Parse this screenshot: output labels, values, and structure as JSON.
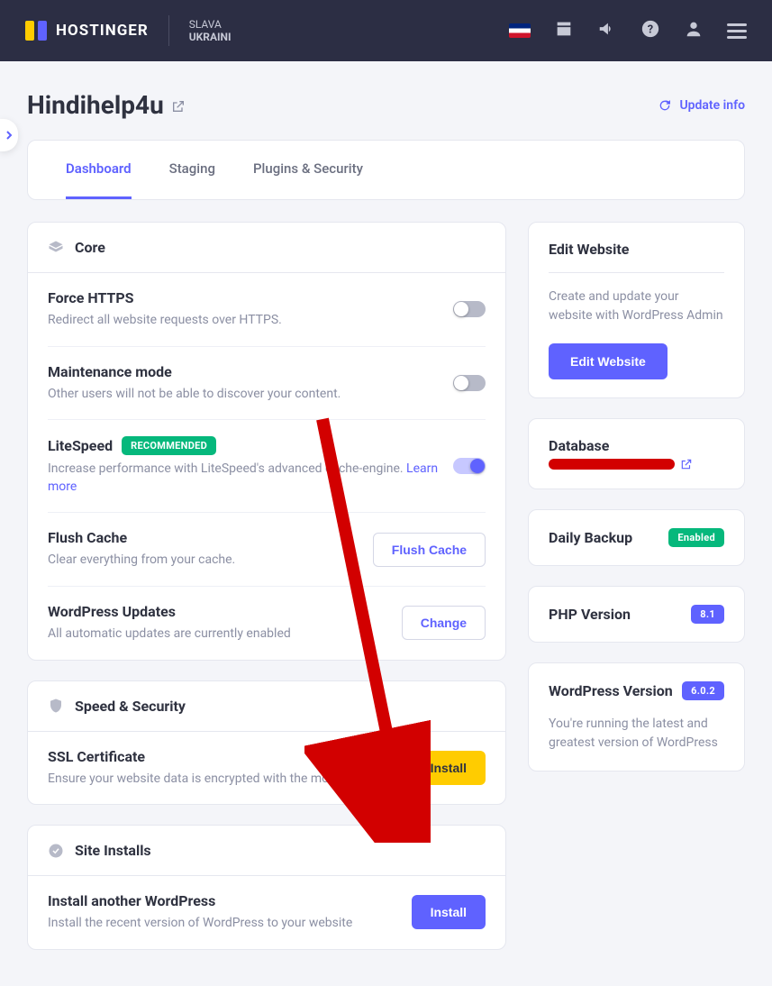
{
  "header": {
    "brand": "HOSTINGER",
    "tagline_top": "SLAVA",
    "tagline_bottom": "UKRAINI"
  },
  "page": {
    "title": "Hindihelp4u",
    "update_info": "Update info"
  },
  "tabs": {
    "dashboard": "Dashboard",
    "staging": "Staging",
    "plugins": "Plugins & Security"
  },
  "core": {
    "section": "Core",
    "force_https": {
      "title": "Force HTTPS",
      "desc": "Redirect all website requests over HTTPS."
    },
    "maintenance": {
      "title": "Maintenance mode",
      "desc": "Other users will not be able to discover your content."
    },
    "litespeed": {
      "title": "LiteSpeed",
      "badge": "RECOMMENDED",
      "desc": "Increase performance with LiteSpeed's advanced cache-engine. ",
      "learn": "Learn more"
    },
    "flush": {
      "title": "Flush Cache",
      "desc": "Clear everything from your cache.",
      "btn": "Flush Cache"
    },
    "updates": {
      "title": "WordPress Updates",
      "desc": "All automatic updates are currently enabled",
      "btn": "Change"
    }
  },
  "speed": {
    "section": "Speed & Security",
    "ssl": {
      "title": "SSL Certificate",
      "desc": "Ensure your website data is encrypted with the most recent SS",
      "btn": "Install"
    }
  },
  "installs": {
    "section": "Site Installs",
    "install_wp": {
      "title": "Install another WordPress",
      "desc": "Install the recent version of WordPress to your website",
      "btn": "Install"
    }
  },
  "right": {
    "edit": {
      "title": "Edit Website",
      "desc": "Create and update your website with WordPress Admin",
      "btn": "Edit Website"
    },
    "database": {
      "title": "Database"
    },
    "backup": {
      "title": "Daily Backup",
      "badge": "Enabled"
    },
    "php": {
      "title": "PHP Version",
      "badge": "8.1"
    },
    "wpver": {
      "title": "WordPress Version",
      "badge": "6.0.2",
      "desc": "You're running the latest and greatest version of WordPress"
    }
  }
}
